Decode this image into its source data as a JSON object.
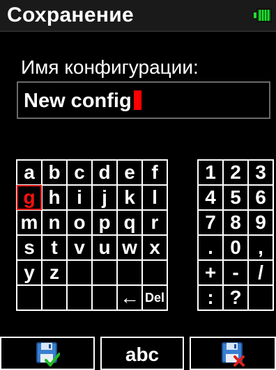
{
  "header": {
    "title": "Сохранение",
    "battery_icon": "battery-full-icon",
    "battery_color": "#22dd33"
  },
  "form": {
    "label": "Имя конфигурации:",
    "value": "New config"
  },
  "keyboard": {
    "letters": [
      [
        "a",
        "b",
        "c",
        "d",
        "e",
        "f"
      ],
      [
        "g",
        "h",
        "i",
        "j",
        "k",
        "l"
      ],
      [
        "m",
        "n",
        "o",
        "p",
        "q",
        "r"
      ],
      [
        "s",
        "t",
        "v",
        "u",
        "w",
        "x"
      ],
      [
        "y",
        "z",
        "",
        "",
        "",
        ""
      ],
      [
        "",
        "",
        "",
        "",
        "←",
        "Del"
      ]
    ],
    "selected": "g",
    "selected_color": "#ff1010",
    "digits": [
      [
        "1",
        "2",
        "3"
      ],
      [
        "4",
        "5",
        "6"
      ],
      [
        "7",
        "8",
        "9"
      ],
      [
        ".",
        "0",
        ","
      ],
      [
        "+",
        "-",
        "/"
      ],
      [
        ":",
        "?",
        ""
      ]
    ]
  },
  "buttons": {
    "save_icon": "save-confirm-icon",
    "mode_label": "abc",
    "cancel_icon": "save-cancel-icon"
  }
}
